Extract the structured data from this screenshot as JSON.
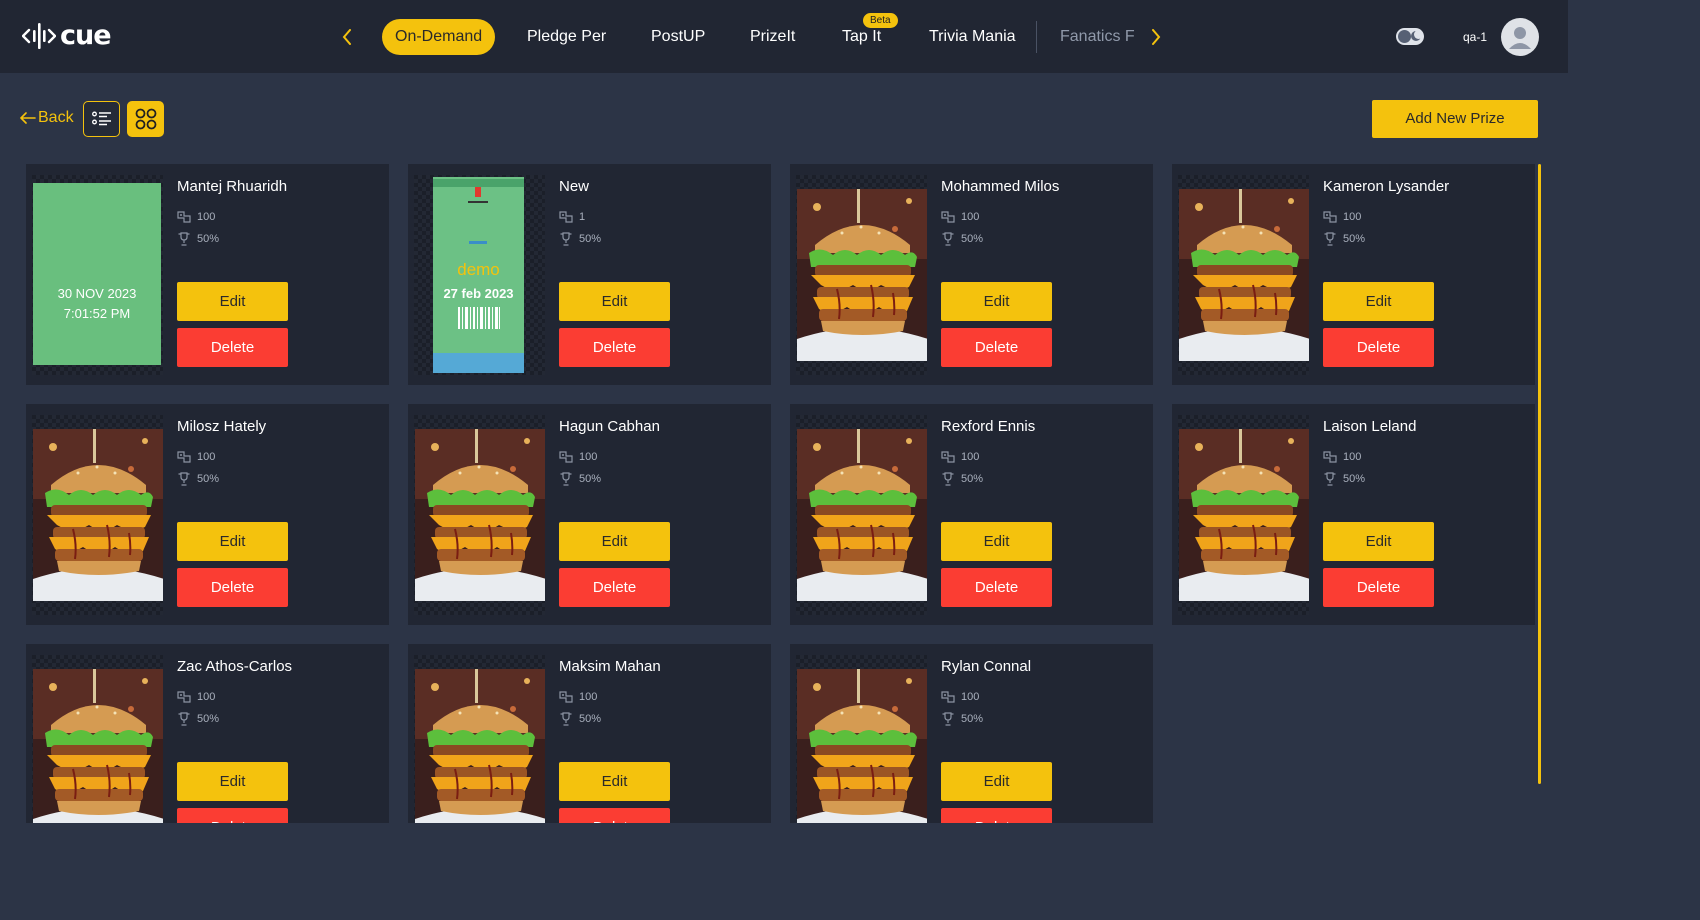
{
  "app": {
    "logo_text": "cue"
  },
  "nav": {
    "items": [
      {
        "label": "On-Demand",
        "active": true
      },
      {
        "label": "Pledge Per"
      },
      {
        "label": "PostUP"
      },
      {
        "label": "PrizeIt"
      },
      {
        "label": "Tap It",
        "badge": "Beta"
      },
      {
        "label": "Trivia Mania"
      },
      {
        "label": "Fanatics F"
      }
    ]
  },
  "user": {
    "name": "qa-1"
  },
  "toolbar": {
    "back_label": "Back",
    "add_label": "Add New Prize"
  },
  "card_labels": {
    "edit": "Edit",
    "delete": "Delete"
  },
  "prizes": [
    {
      "name": "Mantej Rhuaridh",
      "points": "100",
      "percent": "50%",
      "thumb": "green",
      "thumb_date": "30 NOV 2023",
      "thumb_time": "7:01:52 PM"
    },
    {
      "name": "New",
      "points": "1",
      "percent": "50%",
      "thumb": "demo",
      "thumb_word": "demo",
      "thumb_date": "27 feb 2023"
    },
    {
      "name": "Mohammed Milos",
      "points": "100",
      "percent": "50%",
      "thumb": "burger"
    },
    {
      "name": "Kameron Lysander",
      "points": "100",
      "percent": "50%",
      "thumb": "burger"
    },
    {
      "name": "Milosz Hately",
      "points": "100",
      "percent": "50%",
      "thumb": "burger"
    },
    {
      "name": "Hagun Cabhan",
      "points": "100",
      "percent": "50%",
      "thumb": "burger"
    },
    {
      "name": "Rexford Ennis",
      "points": "100",
      "percent": "50%",
      "thumb": "burger"
    },
    {
      "name": "Laison Leland",
      "points": "100",
      "percent": "50%",
      "thumb": "burger"
    },
    {
      "name": "Zac Athos-Carlos",
      "points": "100",
      "percent": "50%",
      "thumb": "burger"
    },
    {
      "name": "Maksim Mahan",
      "points": "100",
      "percent": "50%",
      "thumb": "burger"
    },
    {
      "name": "Rylan Connal",
      "points": "100",
      "percent": "50%",
      "thumb": "burger"
    }
  ],
  "colors": {
    "accent": "#f4c20d",
    "danger": "#fb3d33",
    "card": "#212633",
    "page": "#2c3446"
  }
}
